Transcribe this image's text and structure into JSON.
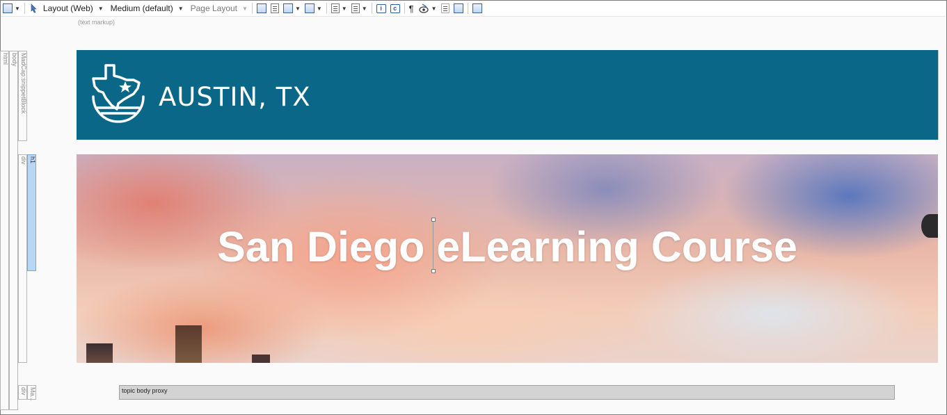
{
  "toolbar": {
    "layout_label": "Layout (Web)",
    "medium_label": "Medium (default)",
    "page_layout_label": "Page Layout"
  },
  "text_markup_label": "(text markup)",
  "structure": {
    "html": "html",
    "body": "body",
    "snippet": "MadCap:snippetBlock",
    "div": "div",
    "h1": "h1",
    "div2": "div",
    "madcap_short": "Ma..."
  },
  "banner": {
    "brand": "AUSTIN, TX",
    "color": "#0b6787"
  },
  "hero": {
    "title": "San Diego eLearning Course"
  },
  "proxy": {
    "label": "topic body proxy"
  }
}
